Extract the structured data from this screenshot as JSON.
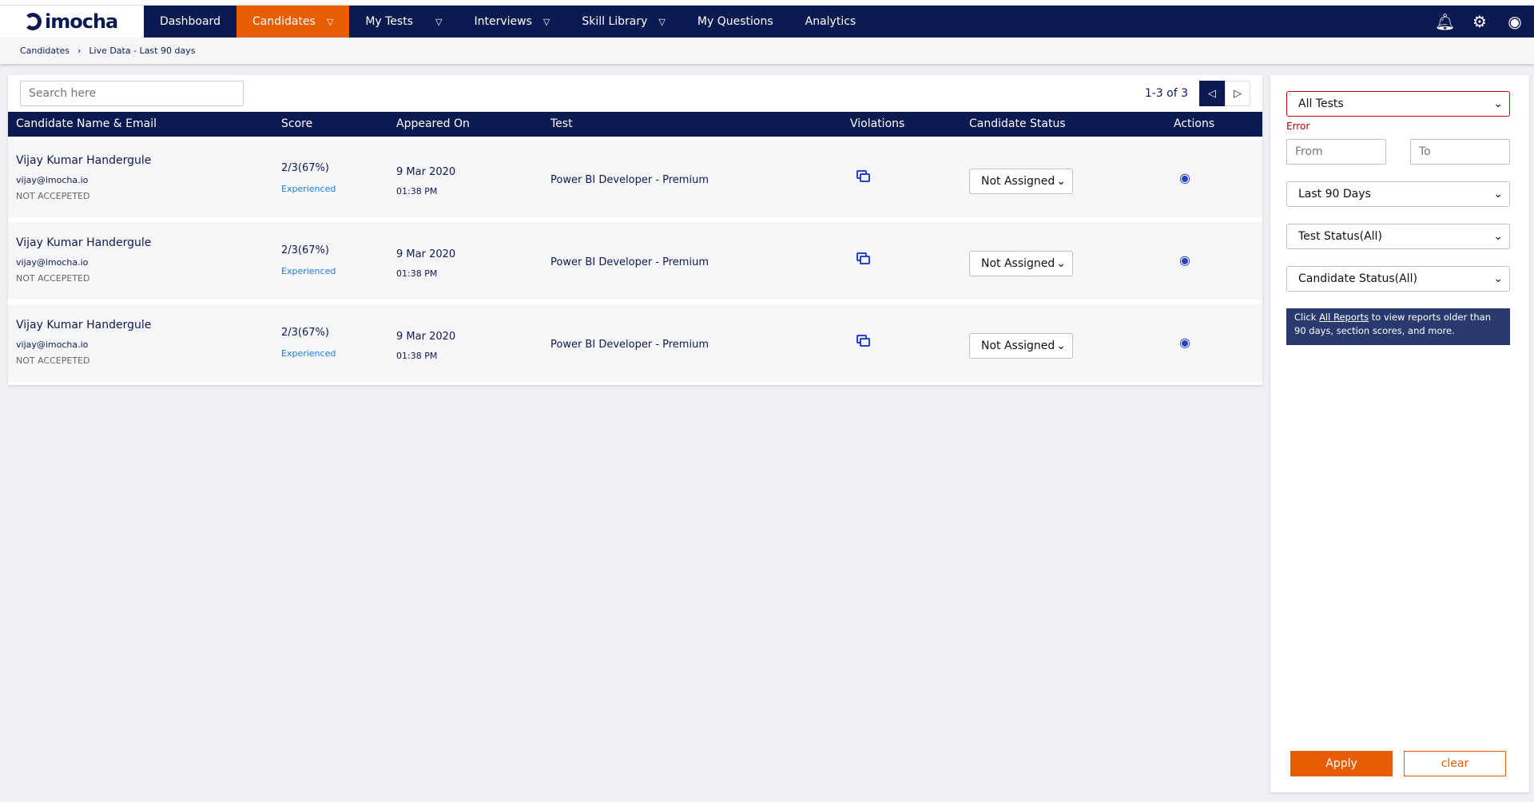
{
  "brand": "imocha",
  "nav": {
    "items": [
      {
        "label": "Dashboard",
        "dropdown": false
      },
      {
        "label": "Candidates",
        "dropdown": true,
        "active": true
      },
      {
        "label": "My Tests",
        "dropdown": true
      },
      {
        "label": "Interviews",
        "dropdown": true
      },
      {
        "label": "Skill Library",
        "dropdown": true
      },
      {
        "label": "My Questions",
        "dropdown": false
      },
      {
        "label": "Analytics",
        "dropdown": false
      }
    ],
    "icons": [
      "bell-icon",
      "gear-icon",
      "user-icon"
    ]
  },
  "breadcrumb": {
    "items": [
      "Candidates",
      "Live Data - Last 90 days"
    ],
    "separator": "›"
  },
  "search": {
    "placeholder": "Search here"
  },
  "pagination": {
    "text": "1-3 of 3"
  },
  "table": {
    "headers": [
      "Candidate Name & Email",
      "Score",
      "Appeared On",
      "Test",
      "Violations",
      "Candidate Status",
      "Actions"
    ],
    "rows": [
      {
        "name": "Vijay Kumar Handergule",
        "email": "vijay@imocha.io",
        "invite_status": "NOT ACCEPETED",
        "score": "2/3(67%)",
        "level": "Experienced",
        "date": "9 Mar 2020",
        "time": "01:38 PM",
        "test": "Power BI Developer - Premium",
        "status": "Not Assigned"
      },
      {
        "name": "Vijay Kumar Handergule",
        "email": "vijay@imocha.io",
        "invite_status": "NOT ACCEPETED",
        "score": "2/3(67%)",
        "level": "Experienced",
        "date": "9 Mar 2020",
        "time": "01:38 PM",
        "test": "Power BI Developer - Premium",
        "status": "Not Assigned"
      },
      {
        "name": "Vijay Kumar Handergule",
        "email": "vijay@imocha.io",
        "invite_status": "NOT ACCEPETED",
        "score": "2/3(67%)",
        "level": "Experienced",
        "date": "9 Mar 2020",
        "time": "01:38 PM",
        "test": "Power BI Developer - Premium",
        "status": "Not Assigned"
      }
    ]
  },
  "filters": {
    "test": "All Tests",
    "error": "Error",
    "from_placeholder": "From",
    "to_placeholder": "To",
    "period": "Last 90 Days",
    "test_status": "Test Status(All)",
    "candidate_status": "Candidate Status(All)",
    "info_prefix": "Click",
    "info_link": "All Reports",
    "info_suffix": "to view reports older than 90 days, section scores, and more.",
    "apply": "Apply",
    "clear": "clear"
  },
  "colors": {
    "nav": "#0c1a52",
    "accent": "#e85d04",
    "error": "#c00000",
    "link": "#1a7ee6"
  }
}
